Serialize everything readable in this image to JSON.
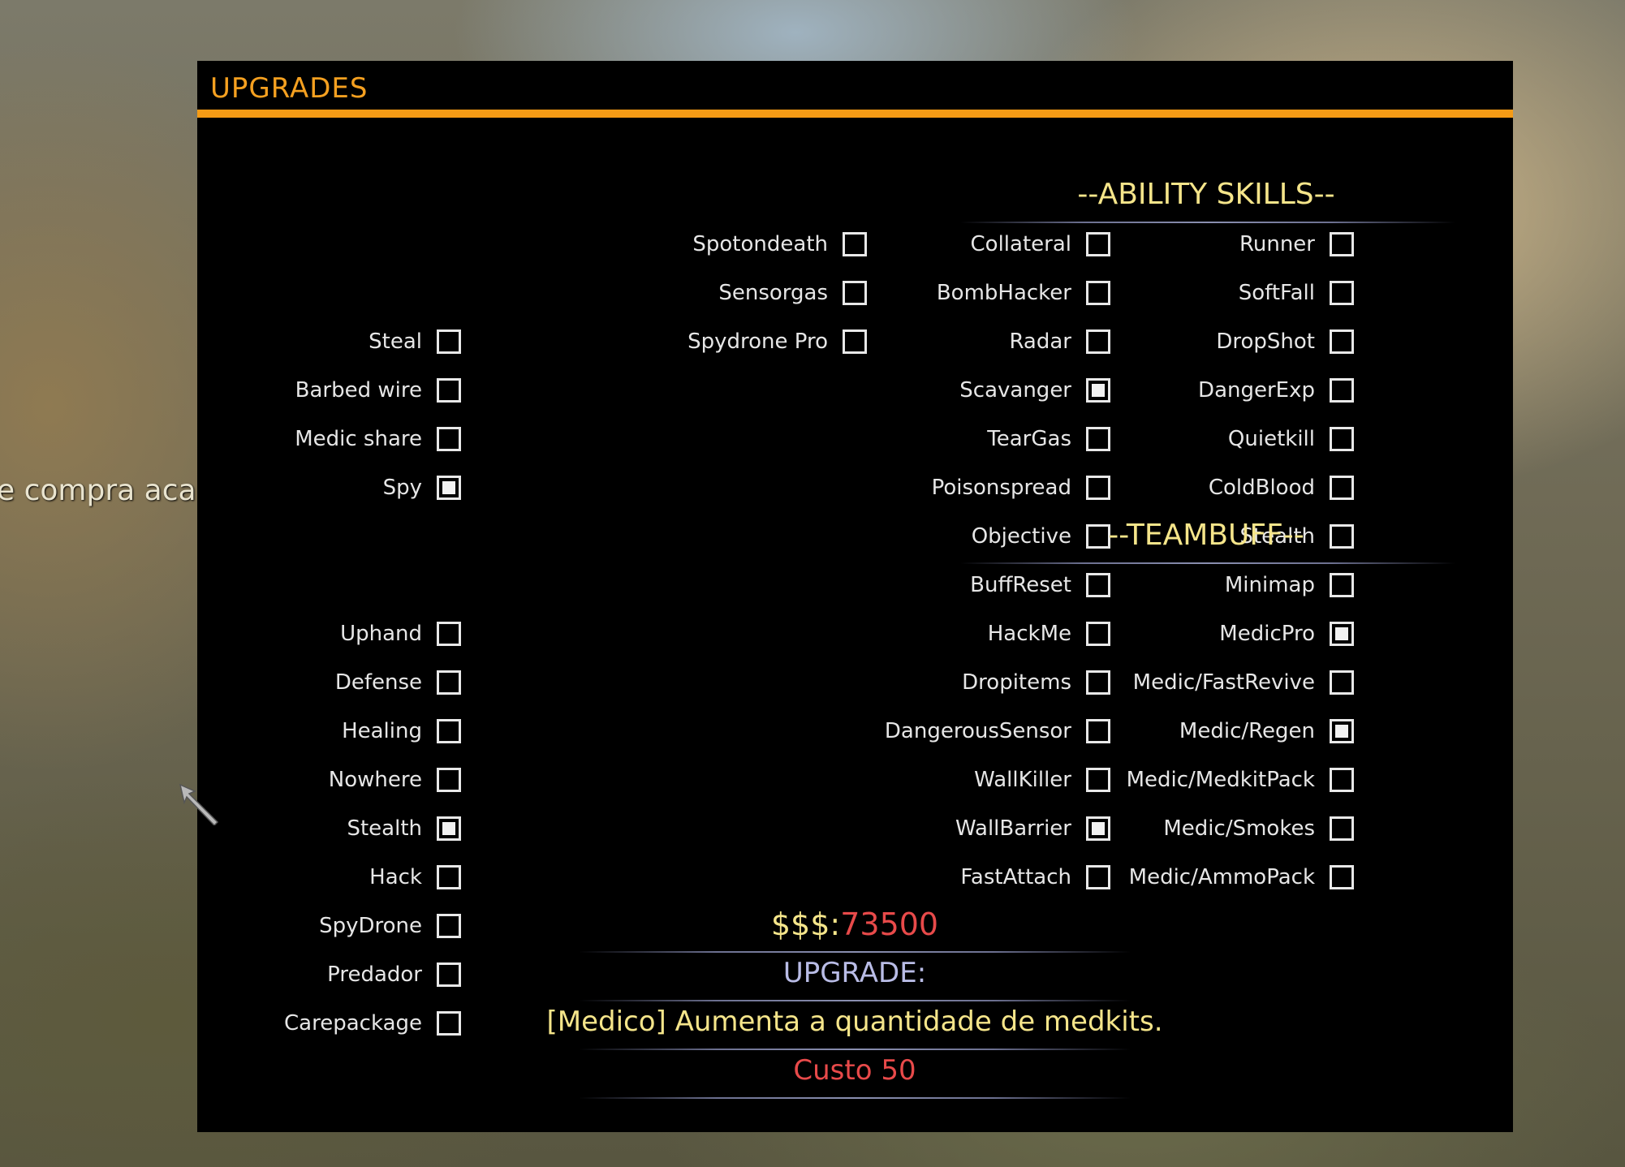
{
  "chat": {
    "text": "e compra acabo"
  },
  "panel": {
    "title": "UPGRADES"
  },
  "col1": [
    {
      "label": "Runner",
      "checked": false
    },
    {
      "label": "SoftFall",
      "checked": false
    },
    {
      "label": "DropShot",
      "checked": false
    },
    {
      "label": "DangerExp",
      "checked": false
    },
    {
      "label": "Quietkill",
      "checked": false
    },
    {
      "label": "ColdBlood",
      "checked": false
    },
    {
      "label": "Stealth",
      "checked": false
    },
    {
      "label": "Minimap",
      "checked": false
    },
    {
      "label": "MedicPro",
      "checked": true
    },
    {
      "label": "Medic/FastRevive",
      "checked": false
    },
    {
      "label": "Medic/Regen",
      "checked": true
    },
    {
      "label": "Medic/MedkitPack",
      "checked": false
    },
    {
      "label": "Medic/Smokes",
      "checked": false
    },
    {
      "label": "Medic/AmmoPack",
      "checked": false
    }
  ],
  "col2": [
    {
      "label": "Collateral",
      "checked": false
    },
    {
      "label": "BombHacker",
      "checked": false
    },
    {
      "label": "Radar",
      "checked": false
    },
    {
      "label": "Scavanger",
      "checked": true
    },
    {
      "label": "TearGas",
      "checked": false
    },
    {
      "label": "Poisonspread",
      "checked": false
    },
    {
      "label": "Objective",
      "checked": false
    },
    {
      "label": "BuffReset",
      "checked": false
    },
    {
      "label": "HackMe",
      "checked": false
    },
    {
      "label": "Dropitems",
      "checked": false
    },
    {
      "label": "DangerousSensor",
      "checked": false
    },
    {
      "label": "WallKiller",
      "checked": false
    },
    {
      "label": "WallBarrier",
      "checked": true
    },
    {
      "label": "FastAttach",
      "checked": false
    }
  ],
  "col3": [
    {
      "label": "Spotondeath",
      "checked": false
    },
    {
      "label": "Sensorgas",
      "checked": false
    },
    {
      "label": "Spydrone Pro",
      "checked": false
    }
  ],
  "ability": {
    "heading": "--ABILITY SKILLS--",
    "items": [
      {
        "label": "Steal",
        "checked": false
      },
      {
        "label": "Barbed wire",
        "checked": false
      },
      {
        "label": "Medic share",
        "checked": false
      },
      {
        "label": "Spy",
        "checked": true
      }
    ]
  },
  "teambuff": {
    "heading": "--TEAMBUFF--",
    "items": [
      {
        "label": "Uphand",
        "checked": false
      },
      {
        "label": "Defense",
        "checked": false
      },
      {
        "label": "Healing",
        "checked": false
      },
      {
        "label": "Nowhere",
        "checked": false
      },
      {
        "label": "Stealth",
        "checked": true
      },
      {
        "label": "Hack",
        "checked": false
      },
      {
        "label": "SpyDrone",
        "checked": false
      },
      {
        "label": "Predador",
        "checked": false
      },
      {
        "label": "Carepackage",
        "checked": false
      }
    ]
  },
  "info": {
    "money_label": "$$$:",
    "money_value": "73500",
    "upgrade_label": "UPGRADE:",
    "description": "[Medico] Aumenta a quantidade de medkits.",
    "cost": "Custo 50"
  },
  "colors": {
    "accent": "#f59b15",
    "title": "#f5a020",
    "heading": "#f5e58a",
    "money": "#e84a4a",
    "upgrade_label": "#b9bce6",
    "description": "#f5e58a",
    "cost": "#e84a4a"
  }
}
